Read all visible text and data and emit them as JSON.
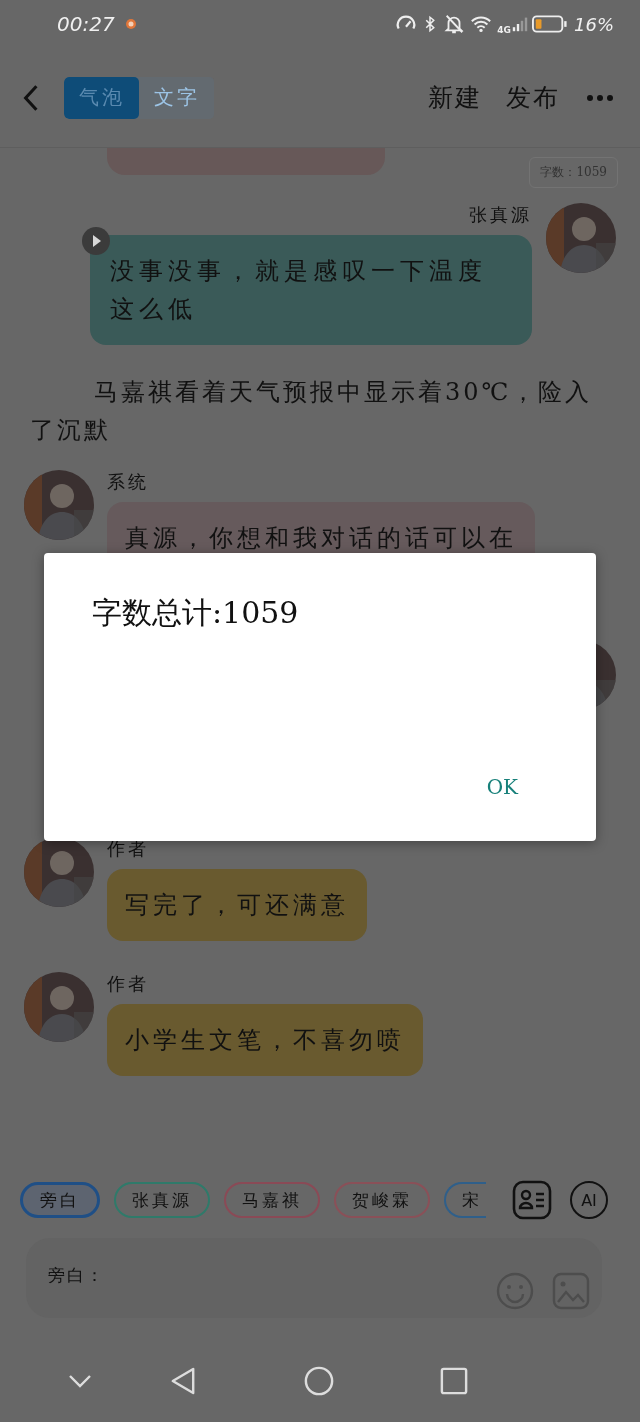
{
  "status_bar": {
    "time": "00:27",
    "network": "4G",
    "battery": "16%"
  },
  "header": {
    "tabs": [
      {
        "label": "气泡",
        "selected": true
      },
      {
        "label": "文字",
        "selected": false
      }
    ],
    "actions": [
      "新建",
      "发布"
    ]
  },
  "word_count": "字数：1059",
  "messages": [
    {
      "kind": "partial",
      "color": "#675858"
    },
    {
      "kind": "bubble_right",
      "name": "张真源",
      "text": "没事没事，就是感叹一下温度这么低",
      "color": "#3a5a58",
      "voice": true
    },
    {
      "kind": "narration",
      "text": "马嘉祺看着天气预报中显示着30℃，险入了沉默"
    },
    {
      "kind": "bubble_left",
      "name": "系统",
      "text": "真源，你想和我对话的话可以在",
      "color": "#665a5c",
      "voice": false
    },
    {
      "kind": "avatar_right"
    },
    {
      "kind": "bubble_left",
      "name": "作者",
      "text": "写完了，可还满意",
      "color": "#695a2f",
      "voice": false
    },
    {
      "kind": "bubble_left",
      "name": "作者",
      "text": "小学生文笔，不喜勿喷",
      "color": "#695a2f",
      "voice": false
    }
  ],
  "roles": [
    {
      "label": "旁白",
      "selected": true,
      "color": "#1f4f86"
    },
    {
      "label": "张真源",
      "selected": false,
      "color": "#2f7a6a"
    },
    {
      "label": "马嘉祺",
      "selected": false,
      "color": "#8a4a56"
    },
    {
      "label": "贺峻霖",
      "selected": false,
      "color": "#8a5058"
    },
    {
      "label": "宋",
      "selected": false,
      "color": "#2f5f8a"
    }
  ],
  "ai_button": "AI",
  "composer": {
    "prefix": "旁白："
  },
  "dialog": {
    "message": "字数总计:1059",
    "button": "OK"
  }
}
